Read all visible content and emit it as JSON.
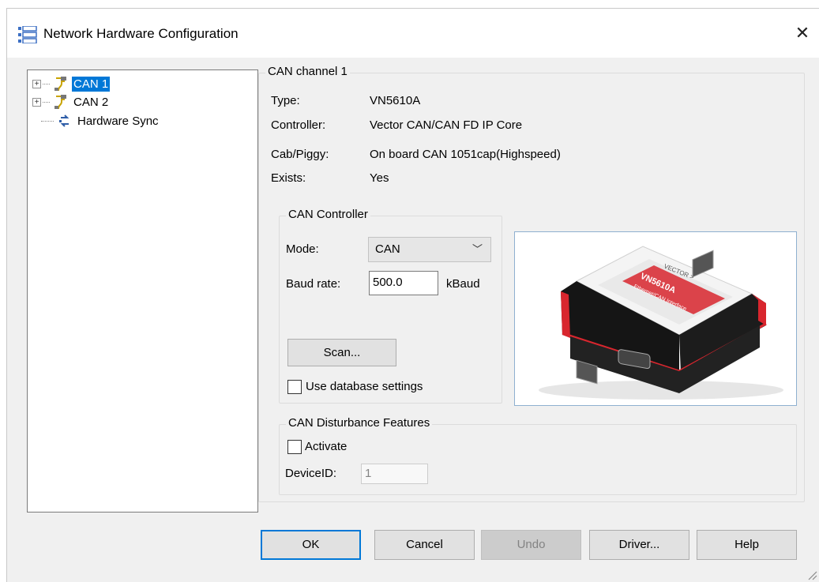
{
  "window": {
    "title": "Network Hardware Configuration",
    "close_label": "✕"
  },
  "tree": {
    "items": [
      {
        "label": "CAN 1",
        "expander": "+",
        "selected": true
      },
      {
        "label": "CAN 2",
        "expander": "+"
      },
      {
        "label": "Hardware Sync"
      }
    ]
  },
  "channel": {
    "group_title": "CAN channel 1",
    "type_label": "Type:",
    "type_value": "VN5610A",
    "controller_label": "Controller:",
    "controller_value": "Vector CAN/CAN FD IP Core",
    "cab_label": "Cab/Piggy:",
    "cab_value": "On board CAN 1051cap(Highspeed)",
    "exists_label": "Exists:",
    "exists_value": "Yes"
  },
  "can_controller": {
    "group_title": "CAN Controller",
    "mode_label": "Mode:",
    "mode_value": "CAN",
    "baud_label": "Baud rate:",
    "baud_value": "500.0",
    "baud_unit": "kBaud",
    "scan_button": "Scan...",
    "use_db_label": "Use database settings"
  },
  "device_image": {
    "brand": "VECTOR >",
    "model": "VN5610A",
    "subtitle": "Ethernet/CAN Interface"
  },
  "disturbance": {
    "group_title": "CAN Disturbance Features",
    "activate_label": "Activate",
    "device_id_label": "DeviceID:",
    "device_id_value": "1"
  },
  "buttons": {
    "ok": "OK",
    "cancel": "Cancel",
    "undo": "Undo",
    "driver": "Driver...",
    "help": "Help"
  },
  "colors": {
    "selection": "#0078d7",
    "accent_red": "#d8262e"
  }
}
